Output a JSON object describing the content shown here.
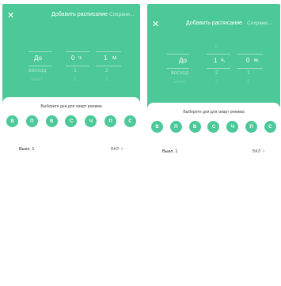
{
  "header": {
    "close_icon": "close-icon",
    "title": "Добавить расписание",
    "save_label": "Сохрани..."
  },
  "picker1": {
    "selected": {
      "mode": "До",
      "hours": "0",
      "hours_unit": "ч.",
      "minutes": "1",
      "minutes_unit": "м."
    },
    "below": {
      "mode": "восход",
      "hours": "1",
      "minutes": "2"
    },
    "below2": {
      "mode": "закат",
      "hours": "2",
      "minutes": "3"
    }
  },
  "picker2": {
    "above": {
      "minutes": "0"
    },
    "selected": {
      "mode": "До",
      "hours": "1",
      "hours_unit": "ч.",
      "minutes": "0",
      "minutes_unit": "м."
    },
    "below": {
      "mode": "восход",
      "hours": "2",
      "minutes": "1"
    },
    "below2": {
      "mode": "закат",
      "hours": "3",
      "minutes": "2"
    }
  },
  "sheet": {
    "prompt": "Выберите дни для смарт режима",
    "days": [
      "В",
      "П",
      "В",
      "С",
      "Ч",
      "П",
      "С"
    ],
    "option_label": "Выкл. 1",
    "option_value": "ВКЛ",
    "chevron_icon": "chevron-right-icon"
  },
  "colors": {
    "accent": "#4dc999",
    "sheet": "#ffffff"
  }
}
